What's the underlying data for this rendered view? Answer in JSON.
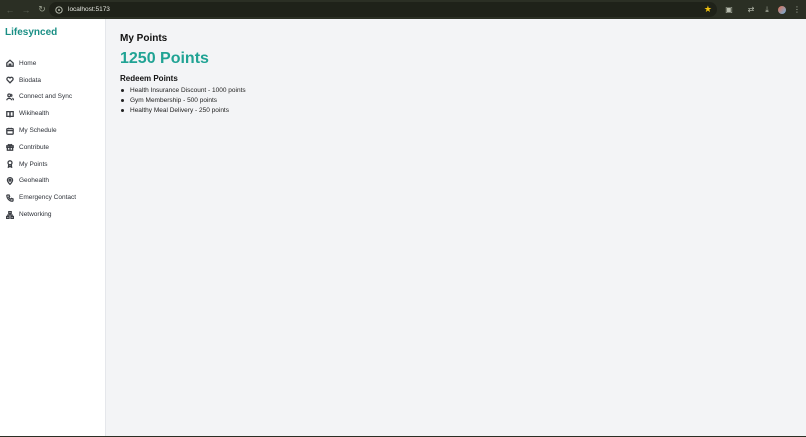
{
  "browser": {
    "url": "localhost:5173"
  },
  "sidebar": {
    "logo": "Lifesynced",
    "items": [
      {
        "label": "Home",
        "icon": "home-icon"
      },
      {
        "label": "Biodata",
        "icon": "heart-icon"
      },
      {
        "label": "Connect and Sync",
        "icon": "users-icon"
      },
      {
        "label": "Wikihealth",
        "icon": "book-icon"
      },
      {
        "label": "My Schedule",
        "icon": "calendar-icon"
      },
      {
        "label": "Contribute",
        "icon": "gift-icon"
      },
      {
        "label": "My Points",
        "icon": "award-icon"
      },
      {
        "label": "Geohealth",
        "icon": "map-pin-icon"
      },
      {
        "label": "Emergency Contact",
        "icon": "phone-icon"
      },
      {
        "label": "Networking",
        "icon": "network-icon"
      }
    ]
  },
  "main": {
    "title": "My Points",
    "points": "1250 Points",
    "redeem_title": "Redeem Points",
    "rewards": [
      "Health Insurance Discount - 1000 points",
      "Gym Membership - 500 points",
      "Healthy Meal Delivery - 250 points"
    ]
  },
  "colors": {
    "accent": "#20a394",
    "logo": "#1a8f85",
    "background": "#f3f4f6"
  }
}
